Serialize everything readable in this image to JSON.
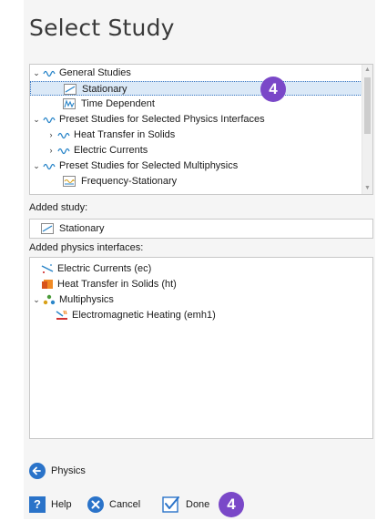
{
  "dialog": {
    "title": "Select Study"
  },
  "study_tree": {
    "items": [
      {
        "label": "General Studies",
        "expanded": true,
        "icon": "study-group-icon"
      },
      {
        "label": "Stationary",
        "selected": true,
        "icon": "stationary-study-icon"
      },
      {
        "label": "Time Dependent",
        "icon": "time-dependent-study-icon"
      },
      {
        "label": "Preset Studies for Selected Physics Interfaces",
        "expanded": true,
        "icon": "study-group-icon"
      },
      {
        "label": "Heat Transfer in Solids",
        "expanded": false,
        "icon": "study-group-icon"
      },
      {
        "label": "Electric Currents",
        "expanded": false,
        "icon": "study-group-icon"
      },
      {
        "label": "Preset Studies for Selected Multiphysics",
        "expanded": true,
        "icon": "study-group-icon"
      },
      {
        "label": "Frequency-Stationary",
        "icon": "frequency-stationary-study-icon"
      }
    ]
  },
  "added_study": {
    "heading": "Added study:",
    "value": "Stationary"
  },
  "physics": {
    "heading": "Added physics interfaces:",
    "items": [
      {
        "label": "Electric Currents (ec)",
        "icon": "electric-currents-icon"
      },
      {
        "label": "Heat Transfer in Solids (ht)",
        "icon": "heat-transfer-icon"
      },
      {
        "label": "Multiphysics",
        "icon": "multiphysics-icon",
        "expanded": true
      },
      {
        "label": "Electromagnetic Heating (emh1)",
        "icon": "electromagnetic-heating-icon"
      }
    ]
  },
  "nav": {
    "physics_label": "Physics"
  },
  "footer": {
    "help_label": "Help",
    "cancel_label": "Cancel",
    "done_label": "Done"
  },
  "badges": {
    "top": "4",
    "bottom": "4"
  },
  "colors": {
    "accent": "#2a73c9",
    "badge": "#7a48c8",
    "selection": "#dbe9f7"
  }
}
